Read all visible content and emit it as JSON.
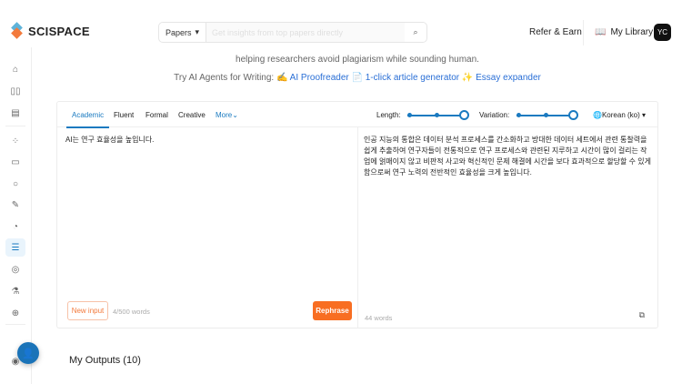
{
  "header": {
    "brand": "SCISPACE",
    "search_scope": "Papers",
    "search_placeholder": "Get insights from top papers directly",
    "refer": "Refer & Earn",
    "library": "My Library",
    "avatar": "YC"
  },
  "colors": {
    "accent": "#1a7ac0",
    "orange": "#f86e22"
  },
  "intro": {
    "line2": "helping researchers avoid plagiarism while sounding human.",
    "agents_label": "Try AI Agents for Writing:",
    "agents": [
      "AI Proofreader",
      "1-click article generator",
      "Essay expander"
    ]
  },
  "tabs": [
    "Academic",
    "Fluent",
    "Formal",
    "Creative",
    "More"
  ],
  "active_tab": "Academic",
  "controls": {
    "length_label": "Length:",
    "length_value": 3,
    "length_max": 3,
    "variation_label": "Variation:",
    "variation_value": 3,
    "variation_max": 3,
    "language": "Korean (ko)"
  },
  "input": {
    "text": "AI는 연구 효율성을 높입니다.",
    "new_input": "New input",
    "word_count": "4/500 words",
    "rephrase": "Rephrase"
  },
  "output": {
    "text": "인공 지능의 통합은 데이터 분석 프로세스를 간소화하고 방대한 데이터 세트에서 관련 통찰력을 쉽게 추출하여 연구자들이 전통적으로 연구 프로세스와 관련된 지루하고 시간이 많이 걸리는 작업에 얽매이지 않고 비판적 사고와 혁신적인 문제 해결에 시간을 보다 효과적으로 할당할 수 있게 함으로써 연구 노력의 전반적인 효율성을 크게 높입니다.",
    "word_count": "44 words"
  },
  "outputs_title": "My Outputs (10)"
}
